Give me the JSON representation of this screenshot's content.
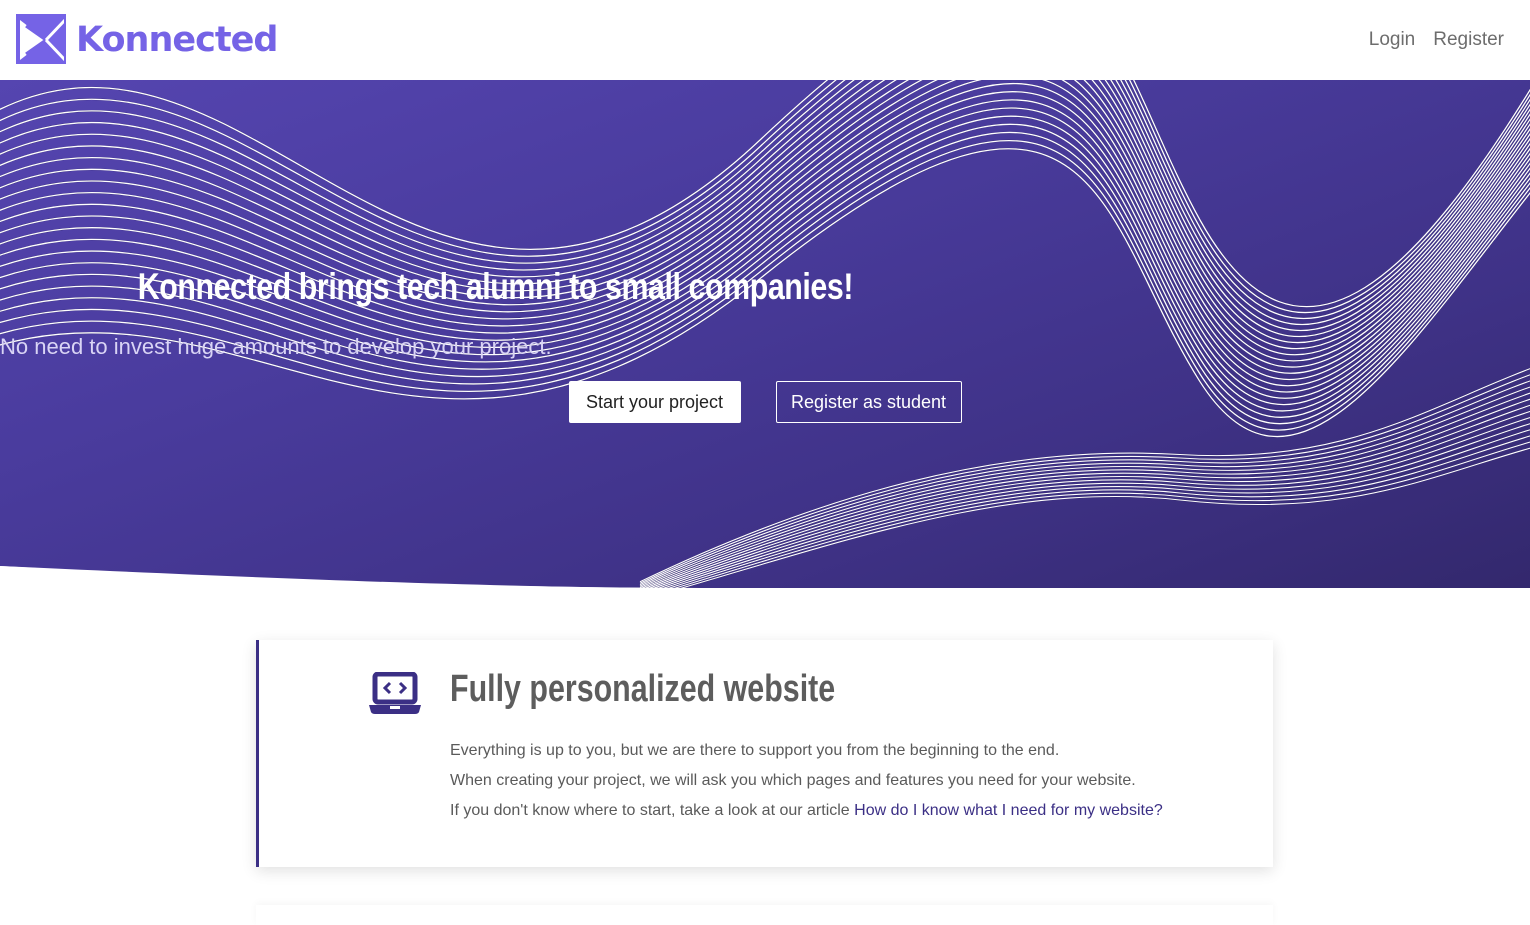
{
  "nav": {
    "brand": "Konnected",
    "login": "Login",
    "register": "Register"
  },
  "hero": {
    "title": "Konnected brings tech alumni to small companies!",
    "subtitle": "No need to invest huge amounts to develop your project.",
    "primary_button": "Start your project",
    "secondary_button": "Register as student"
  },
  "feature": {
    "icon": "laptop-code-icon",
    "title": "Fully personalized website",
    "line1": "Everything is up to you, but we are there to support you from the beginning to the end.",
    "line2": "When creating your project, we will ask you which pages and features you need for your website.",
    "line3_prefix": "If you don't know where to start, take a look at our article ",
    "line3_link": "How do I know what I need for my website?"
  },
  "colors": {
    "brand": "#7563e6",
    "hero_bg": "#4a3c9e",
    "accent": "#3b2f85"
  }
}
